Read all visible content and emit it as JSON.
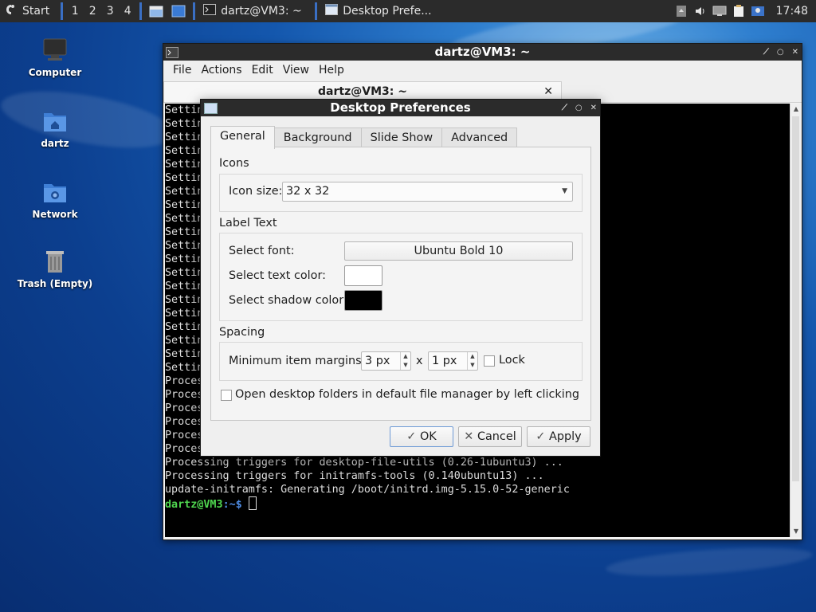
{
  "taskbar": {
    "start_label": "Start",
    "desktops": [
      "1",
      "2",
      "3",
      "4"
    ],
    "tasks": [
      {
        "label": "dartz@VM3: ~",
        "icon": "terminal-icon"
      },
      {
        "label": "Desktop Prefe...",
        "icon": "window-icon"
      }
    ],
    "clock": "17:48"
  },
  "desktop_icons": [
    {
      "label": "Computer",
      "icon": "monitor-icon"
    },
    {
      "label": "dartz",
      "icon": "home-folder-icon"
    },
    {
      "label": "Network",
      "icon": "network-folder-icon"
    },
    {
      "label": "Trash (Empty)",
      "icon": "trash-icon"
    }
  ],
  "terminal": {
    "title": "dartz@VM3: ~",
    "menu": [
      "File",
      "Actions",
      "Edit",
      "View",
      "Help"
    ],
    "tab_label": "dartz@VM3: ~",
    "visible_lines": [
      "Settin",
      "Settin",
      "Settin",
      "Settin",
      "Settin",
      "Settin",
      "Settin",
      "Settin",
      "Settin",
      "Settin",
      "Settin",
      "Settin",
      "Settin",
      "Settin",
      "Settin",
      "Settin",
      "Settin",
      "Settin",
      "Settin",
      "Settin",
      "Proces",
      "Proces",
      "Proces",
      "Proces",
      "Proces",
      "Proces",
      "Processing triggers for desktop-file-utils (0.26-1ubuntu3) ...",
      "Processing triggers for initramfs-tools (0.140ubuntu13) ...",
      "update-initramfs: Generating /boot/initrd.img-5.15.0-52-generic"
    ],
    "prompt_user": "dartz@VM3",
    "prompt_path": ":~$"
  },
  "dialog": {
    "title": "Desktop Preferences",
    "tabs": [
      "General",
      "Background",
      "Slide Show",
      "Advanced"
    ],
    "active_tab": "General",
    "icons_section": "Icons",
    "icon_size_label": "Icon size:",
    "icon_size_value": "32 x 32",
    "label_text_section": "Label Text",
    "select_font_label": "Select font:",
    "font_value": "Ubuntu Bold 10",
    "text_color_label": "Select text color:",
    "text_color": "#ffffff",
    "shadow_color_label": "Select shadow color:",
    "shadow_color": "#000000",
    "spacing_section": "Spacing",
    "margins_label": "Minimum item margins:",
    "margin_x": "3 px",
    "times": "x",
    "margin_y": "1 px",
    "lock_label": "Lock",
    "lock_checked": false,
    "open_folders_label": "Open desktop folders in default file manager by left clicking",
    "open_folders_checked": false,
    "ok_label": "OK",
    "cancel_label": "Cancel",
    "apply_label": "Apply"
  }
}
